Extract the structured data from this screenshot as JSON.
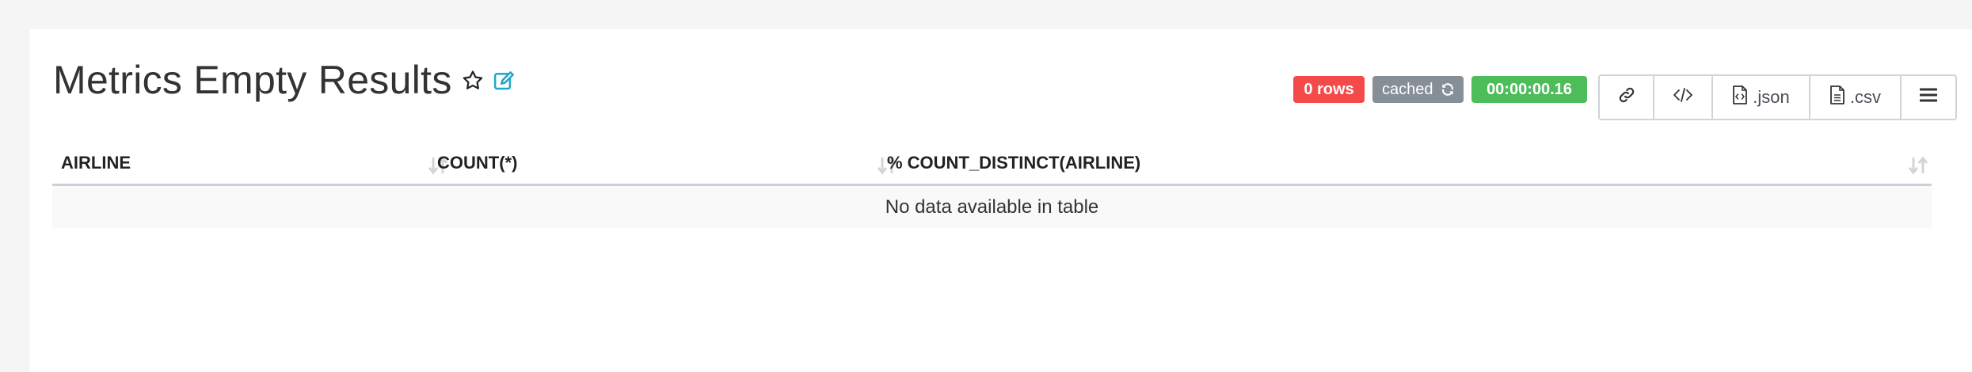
{
  "title": "Metrics Empty Results",
  "badges": {
    "rows": "0 rows",
    "cached": "cached",
    "duration": "00:00:00.16"
  },
  "buttons": {
    "json": ".json",
    "csv": ".csv"
  },
  "table": {
    "columns": [
      "AIRLINE",
      "COUNT(*)",
      "% COUNT_DISTINCT(AIRLINE)"
    ],
    "empty_message": "No data available in table"
  },
  "icons": {
    "star": "star-outline-icon",
    "edit": "edit-icon",
    "refresh": "refresh-icon",
    "link": "link-icon",
    "code": "code-icon",
    "json": "file-code-icon",
    "csv": "file-text-icon",
    "menu": "hamburger-menu-icon",
    "sort": "sort-icon"
  },
  "colors": {
    "rows_badge": "#f44a4a",
    "cached_badge": "#868e96",
    "duration_badge": "#4dbd5a",
    "edit_icon": "#20a7c9"
  }
}
